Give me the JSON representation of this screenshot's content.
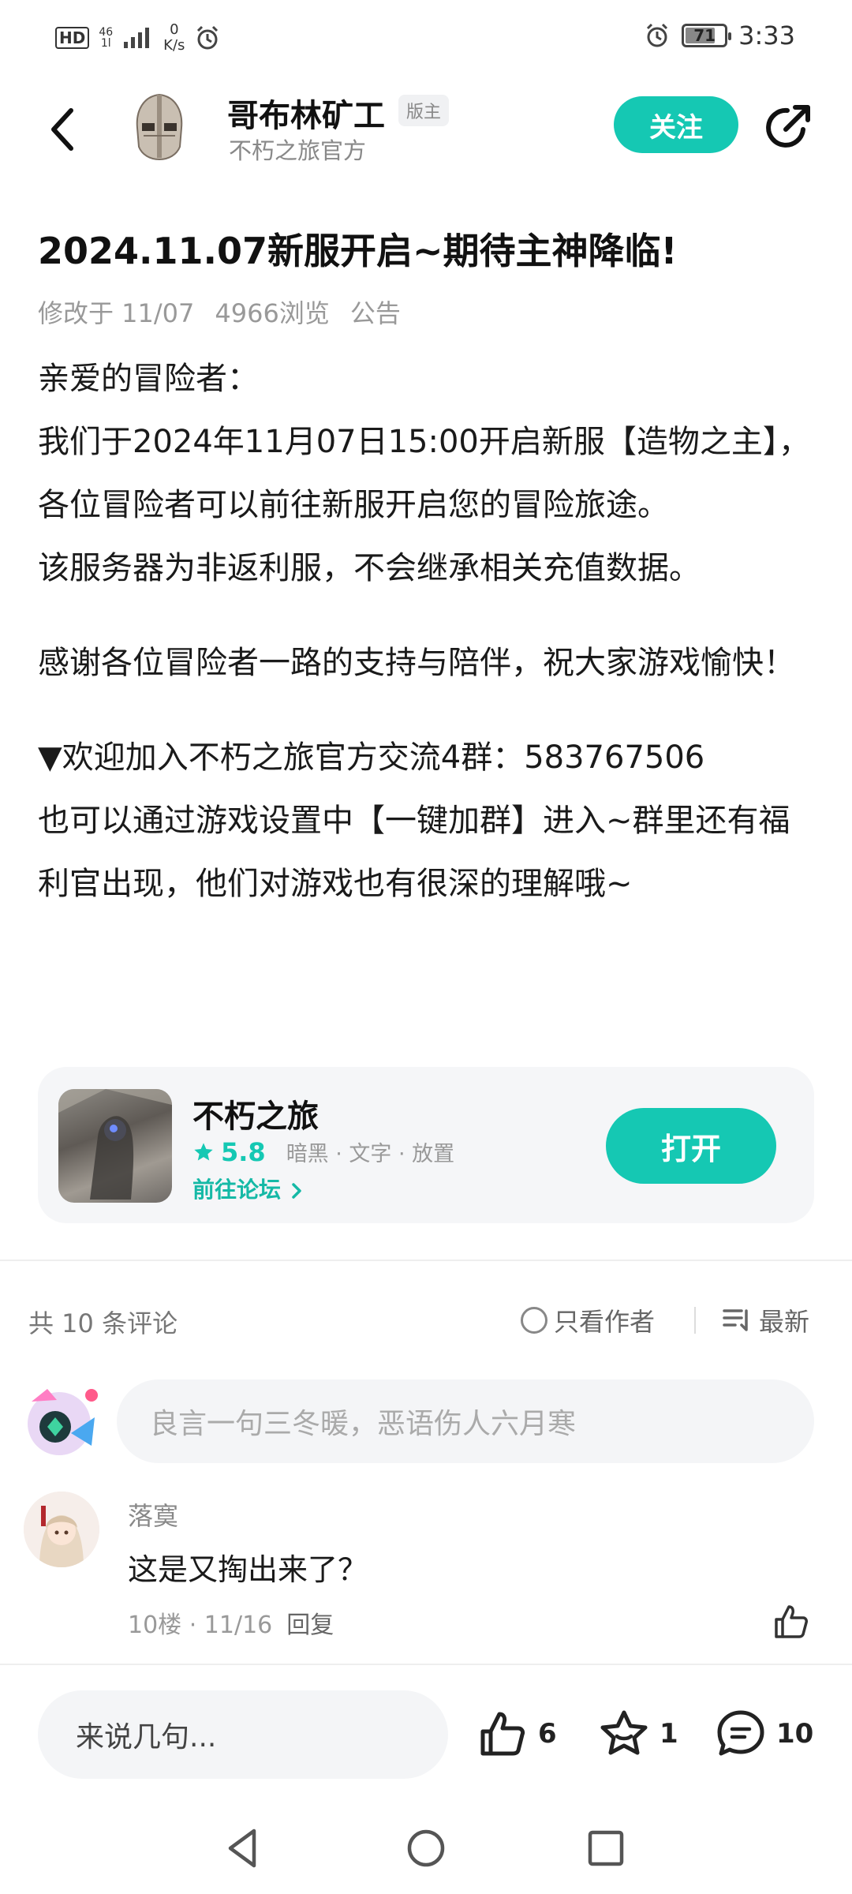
{
  "status_bar": {
    "hd": "HD",
    "network_top": "46",
    "network_bottom": "1l",
    "speed_value": "0",
    "speed_unit": "K/s",
    "battery": "71",
    "time": "3:33"
  },
  "header": {
    "author_name": "哥布林矿工",
    "badge": "版主",
    "author_sub": "不朽之旅官方",
    "follow_label": "关注"
  },
  "article": {
    "title": "2024.11.07新服开启~期待主神降临!",
    "meta": {
      "modified": "修改于 11/07",
      "views": "4966浏览",
      "category": "公告"
    },
    "paragraphs": {
      "p1": "亲爱的冒险者：",
      "p2": "我们于2024年11月07日15:00开启新服【造物之主】，各位冒险者可以前往新服开启您的冒险旅途。",
      "p3": "该服务器为非返利服，不会继承相关充值数据。",
      "p4": "感谢各位冒险者一路的支持与陪伴，祝大家游戏愉快！",
      "p5": "▼欢迎加入不朽之旅官方交流4群：583767506",
      "p6": "也可以通过游戏设置中【一键加群】进入~群里还有福利官出现，他们对游戏也有很深的理解哦~"
    }
  },
  "app_card": {
    "name": "不朽之旅",
    "rating": "5.8",
    "tags": "暗黑 · 文字 · 放置",
    "forum_link": "前往论坛",
    "open_label": "打开"
  },
  "comments": {
    "count_label": "共 10 条评论",
    "author_only_label": "只看作者",
    "sort_label": "最新",
    "input_placeholder": "良言一句三冬暖，恶语伤人六月寒",
    "items": [
      {
        "user": "落寞",
        "text": "这是又掏出来了？",
        "floor_date": "10楼 · 11/16",
        "reply_label": "回复"
      }
    ]
  },
  "bottom_bar": {
    "say_placeholder": "来说几句...",
    "likes": "6",
    "favorites": "1",
    "comments": "10"
  },
  "colors": {
    "accent": "#15c8b3",
    "text_primary": "#1a1a1a",
    "text_secondary": "#999999",
    "card_bg": "#f5f6f8"
  },
  "icons": [
    "back-icon",
    "helmet-avatar",
    "share-icon",
    "star-icon",
    "chevron-right-icon",
    "radio-icon",
    "sort-icon",
    "thumb-up-icon",
    "star-outline-icon",
    "comment-icon",
    "nav-back-icon",
    "nav-home-icon",
    "nav-recents-icon"
  ]
}
